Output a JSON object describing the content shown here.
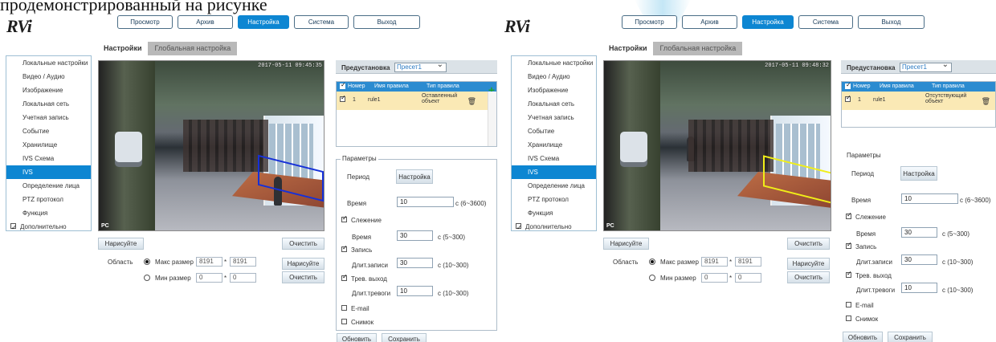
{
  "header_text": "продемонстрированный на рисунке",
  "accent_color": "#0d86d2",
  "panels": [
    {
      "logo": "RVi",
      "nav": [
        "Просмотр",
        "Архив",
        "Настройка",
        "Система",
        "Выход"
      ],
      "tabs": [
        "Настройки",
        "Глобальная настройка"
      ],
      "sidebar": [
        "Локальные настройки",
        "Видео / Аудио",
        "Изображение",
        "Локальная сеть",
        "Учетная запись",
        "Событие",
        "Хранилище",
        "IVS Схема",
        "IVS",
        "Определение лица",
        "PTZ протокол",
        "Функция",
        "Дополнительно"
      ],
      "timestamp": "2017-05-11 09:45:35",
      "pc": "PC",
      "draw_label": "Нарисуйте",
      "clear_label": "Очистить",
      "area_label": "Область",
      "max_size_label": "Макс размер",
      "min_size_label": "Мин размер",
      "max_w": "8191",
      "max_h": "8191",
      "min_w": "0",
      "min_h": "0",
      "preset_label": "Предустановка",
      "preset_value": "Пресет1",
      "rules_headers": [
        "Номер",
        "Имя правила",
        "Тип правила"
      ],
      "rule": {
        "number": "1",
        "name": "rule1",
        "type": "Оставленный объект"
      },
      "params_legend": "Параметры",
      "period": "Период",
      "setup": "Настройка",
      "time_label": "Время",
      "time_value": "10",
      "time_range": "с (6~3600)",
      "tracking": "Слежение",
      "tracking_time": "30",
      "tracking_range": "с (5~300)",
      "record": "Запись",
      "record_duration_label": "Длит.записи",
      "record_duration": "30",
      "record_range": "с (10~300)",
      "alarm": "Трев. выход",
      "alarm_duration_label": "Длит.тревоги",
      "alarm_duration": "10",
      "alarm_range": "с (10~300)",
      "email": "E-mail",
      "snapshot": "Снимок",
      "refresh": "Обновить",
      "save": "Сохранить"
    },
    {
      "logo": "RVi",
      "nav": [
        "Просмотр",
        "Архив",
        "Настройка",
        "Система",
        "Выход"
      ],
      "tabs": [
        "Настройки",
        "Глобальная настройка"
      ],
      "sidebar": [
        "Локальные настройки",
        "Видео / Аудио",
        "Изображение",
        "Локальная сеть",
        "Учетная запись",
        "Событие",
        "Хранилище",
        "IVS Схема",
        "IVS",
        "Определение лица",
        "PTZ протокол",
        "Функция",
        "Дополнительно"
      ],
      "timestamp": "2017-05-11 09:48:32",
      "pc": "PC",
      "draw_label": "Нарисуйте",
      "clear_label": "Очистить",
      "area_label": "Область",
      "max_size_label": "Макс размер",
      "min_size_label": "Мин размер",
      "max_w": "8191",
      "max_h": "8191",
      "min_w": "0",
      "min_h": "0",
      "preset_label": "Предустановка",
      "preset_value": "Пресет1",
      "rules_headers": [
        "Номер",
        "Имя правила",
        "Тип правила"
      ],
      "rule": {
        "number": "1",
        "name": "rule1",
        "type": "Отсутствующий объект"
      },
      "params_legend": "Параметры",
      "period": "Период",
      "setup": "Настройка",
      "time_label": "Время",
      "time_value": "10",
      "time_range": "с (6~3600)",
      "tracking": "Слежение",
      "tracking_time": "30",
      "tracking_range": "с (5~300)",
      "record": "Запись",
      "record_duration_label": "Длит.записи",
      "record_duration": "30",
      "record_range": "с (10~300)",
      "alarm": "Трев. выход",
      "alarm_duration_label": "Длит.тревоги",
      "alarm_duration": "10",
      "alarm_range": "с (10~300)",
      "email": "E-mail",
      "snapshot": "Снимок",
      "refresh": "Обновить",
      "save": "Сохранить"
    }
  ]
}
